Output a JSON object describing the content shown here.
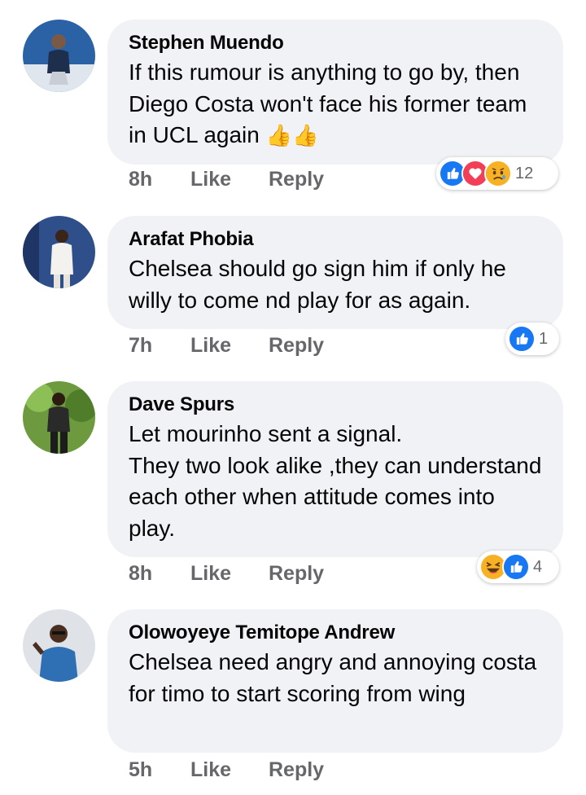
{
  "comments": [
    {
      "author": "Stephen Muendo",
      "text": "If this rumour is anything to go by, then Diego Costa won't face his former team in UCL again",
      "emoji": "👍👍",
      "time": "8h",
      "like": "Like",
      "reply": "Reply",
      "reactions": [
        "like-icon",
        "love-icon",
        "sad-icon"
      ],
      "reaction_count": "12"
    },
    {
      "author": "Arafat Phobia",
      "text": "Chelsea should go sign him if only he willy to come nd play for as again.",
      "time": "7h",
      "like": "Like",
      "reply": "Reply",
      "reactions": [
        "like-icon"
      ],
      "reaction_count": "1"
    },
    {
      "author": "Dave Spurs",
      "text": "Let mourinho sent a signal.\nThey two look alike ,they can understand each other when attitude comes into play.",
      "time": "8h",
      "like": "Like",
      "reply": "Reply",
      "reactions": [
        "haha-icon",
        "like-icon"
      ],
      "reaction_count": "4"
    },
    {
      "author": "Olowoyeye Temitope Andrew",
      "text": "Chelsea need angry and annoying costa for timo to start scoring from wing",
      "time": "5h",
      "like": "Like",
      "reply": "Reply"
    }
  ],
  "colors": {
    "bubble": "#f0f2f5",
    "meta": "#65676b",
    "like_blue": "#1877f2",
    "love_red": "#f33e58",
    "sad_yellow": "#f7b125"
  }
}
